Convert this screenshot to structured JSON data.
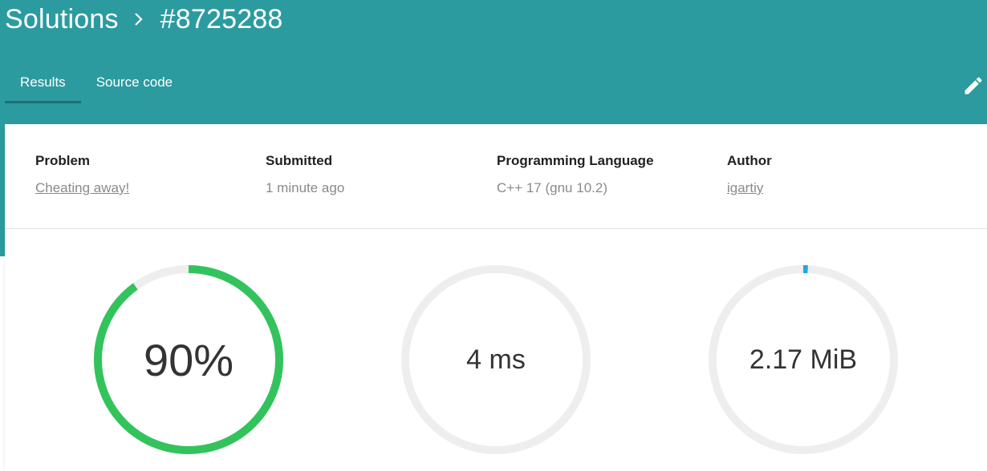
{
  "breadcrumb": {
    "section": "Solutions",
    "item": "#8725288"
  },
  "tabs": [
    {
      "label": "Results",
      "active": true
    },
    {
      "label": "Source code",
      "active": false
    }
  ],
  "details": {
    "problem": {
      "label": "Problem",
      "value": "Cheating away!"
    },
    "submitted": {
      "label": "Submitted",
      "value": "1 minute ago"
    },
    "language": {
      "label": "Programming Language",
      "value": "C++ 17 (gnu 10.2)"
    },
    "author": {
      "label": "Author",
      "value": "igartiy"
    }
  },
  "stats": {
    "score": {
      "text": "90%",
      "fill": 0.9,
      "color": "#33c35d"
    },
    "time": {
      "text": "4 ms",
      "fill": 0.0,
      "color": "#33c35d"
    },
    "memory": {
      "text": "2.17 MiB",
      "fill": 0.008,
      "color": "#1fa8e0"
    }
  },
  "icons": {
    "breadcrumb_separator": "chevron-right-icon",
    "edit": "pencil-icon"
  },
  "colors": {
    "header": "#2b9ba0",
    "tab_indicator": "#1f6f73",
    "track": "#eeeeee"
  }
}
